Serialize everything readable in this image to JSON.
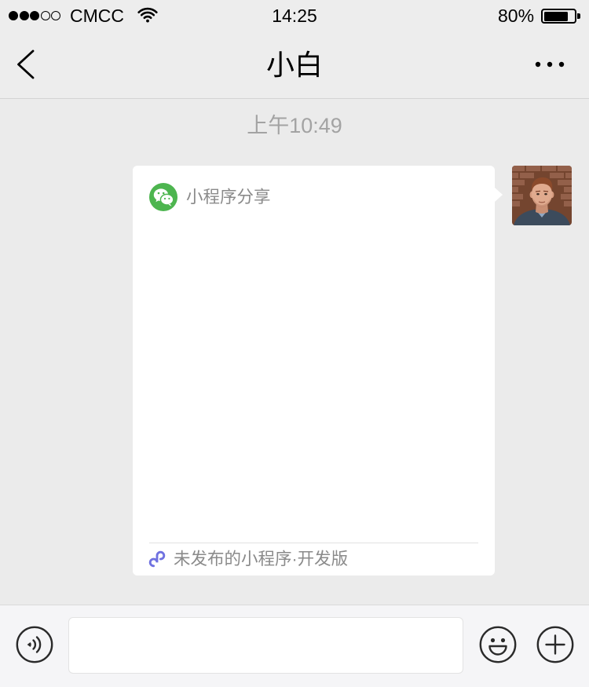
{
  "status_bar": {
    "signal": {
      "filled": 3,
      "total": 5
    },
    "carrier": "CMCC",
    "wifi_icon": "wifi-icon",
    "time": "14:25",
    "battery_text": "80%",
    "battery_level": 0.8,
    "battery_icon": "battery-icon"
  },
  "nav": {
    "back_icon": "chevron-left-icon",
    "title": "小白",
    "more_icon": "more-icon"
  },
  "chat": {
    "timestamp": "上午10:49",
    "messages": [
      {
        "header_icon": "wechat-icon",
        "header_label": "小程序分享",
        "footer_icon": "mini-program-icon",
        "footer_label": "未发布的小程序·开发版",
        "avatar_icon": "avatar-photo-icon"
      }
    ]
  },
  "input_bar": {
    "voice_icon": "voice-icon",
    "message_input": {
      "value": ""
    },
    "emoji_icon": "emoji-icon",
    "plus_icon": "plus-icon"
  },
  "colors": {
    "wechat_green": "#4DB54F",
    "mini_program_accent": "#6F71E0",
    "chat_background": "#EBEBEB",
    "secondary_text": "#8A8A8A"
  }
}
